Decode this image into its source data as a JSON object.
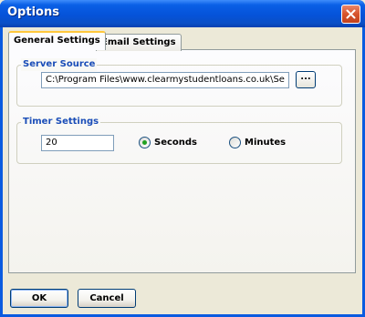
{
  "window": {
    "title": "Options"
  },
  "tabs": [
    {
      "label": "General Settings",
      "active": true
    },
    {
      "label": "Email Settings",
      "active": false
    }
  ],
  "server_source": {
    "label": "Server Source",
    "path_value": "C:\\Program Files\\www.clearmystudentloans.co.uk\\Se",
    "browse_label": "..."
  },
  "timer_settings": {
    "label": "Timer Settings",
    "value": "20",
    "options": [
      {
        "label": "Seconds",
        "selected": true
      },
      {
        "label": "Minutes",
        "selected": false
      }
    ]
  },
  "buttons": {
    "ok": "OK",
    "cancel": "Cancel"
  },
  "colors": {
    "titlebar": "#0553d9",
    "group_label": "#1a4db8",
    "radio_selected": "#21a121",
    "close_button": "#d7532c"
  }
}
